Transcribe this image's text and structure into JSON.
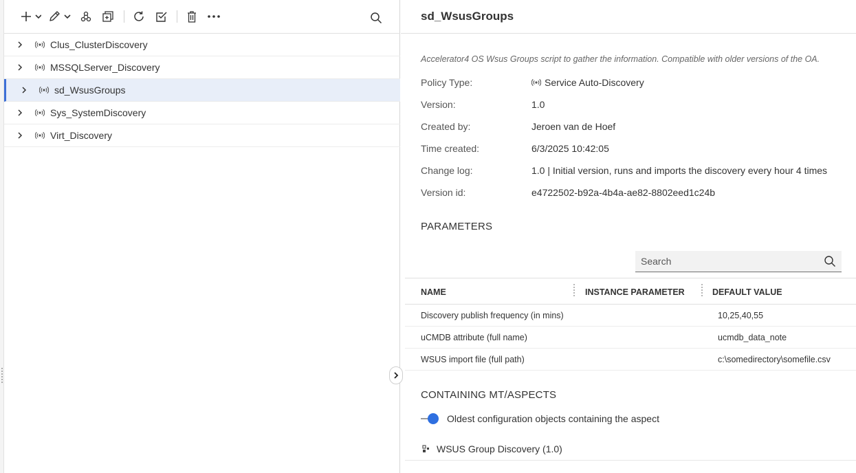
{
  "toolbar": {
    "buttons": [
      "add-icon",
      "edit-icon",
      "link-icon",
      "duplicate-icon",
      "refresh-icon",
      "checkbox-icon",
      "delete-icon",
      "more-icon",
      "search-icon"
    ]
  },
  "tree": {
    "items": [
      {
        "label": "Clus_ClusterDiscovery",
        "selected": false
      },
      {
        "label": "MSSQLServer_Discovery",
        "selected": false
      },
      {
        "label": "sd_WsusGroups",
        "selected": true
      },
      {
        "label": "Sys_SystemDiscovery",
        "selected": false
      },
      {
        "label": "Virt_Discovery",
        "selected": false
      }
    ]
  },
  "details": {
    "title": "sd_WsusGroups",
    "description": "Accelerator4 OS Wsus Groups script to gather the information. Compatible with older versions of the OA.",
    "properties": [
      {
        "label": "Policy Type:",
        "value": "Service Auto-Discovery",
        "icon": "auto-discovery-icon"
      },
      {
        "label": "Version:",
        "value": "1.0"
      },
      {
        "label": "Created by:",
        "value": "Jeroen van de Hoef"
      },
      {
        "label": "Time created:",
        "value": "6/3/2025 10:42:05"
      },
      {
        "label": "Change log:",
        "value": "1.0 | Initial version, runs and imports the discovery every hour 4 times"
      },
      {
        "label": "Version id:",
        "value": "e4722502-b92a-4b4a-ae82-8802eed1c24b"
      }
    ]
  },
  "parameters": {
    "heading": "PARAMETERS",
    "search_placeholder": "Search",
    "columns": [
      "NAME",
      "INSTANCE PARAMETER",
      "DEFAULT VALUE"
    ],
    "rows": [
      {
        "name": "Discovery publish frequency (in mins)",
        "instance": "",
        "default": "10,25,40,55"
      },
      {
        "name": "uCMDB attribute (full name)",
        "instance": "",
        "default": "ucmdb_data_note"
      },
      {
        "name": "WSUS import file (full path)",
        "instance": "",
        "default": "c:\\somedirectory\\somefile.csv"
      }
    ]
  },
  "containing": {
    "heading": "CONTAINING MT/ASPECTS",
    "toggle_label": "Oldest configuration objects containing the aspect",
    "toggle_on": true,
    "items": [
      {
        "label": "WSUS Group Discovery (1.0)",
        "icon": "aspect-icon"
      }
    ]
  },
  "colors": {
    "accent": "#2e6fe0",
    "selected_row": "#e8eef9",
    "selected_border": "#3d6fd6"
  }
}
